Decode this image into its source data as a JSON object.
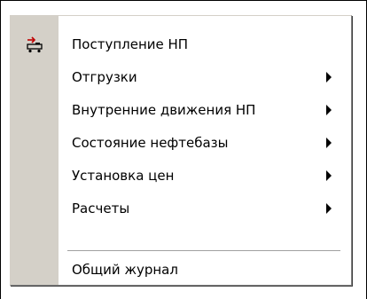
{
  "menu": {
    "items": [
      {
        "label": "Поступление НП",
        "icon": "fuel-truck-icon",
        "has_submenu": false
      },
      {
        "label": "Отгрузки",
        "has_submenu": true
      },
      {
        "label": "Внутренние движения НП",
        "has_submenu": true
      },
      {
        "label": "Состояние нефтебазы",
        "has_submenu": true
      },
      {
        "label": "Установка цен",
        "has_submenu": true
      },
      {
        "label": "Расчеты",
        "has_submenu": true
      },
      {
        "label": "Общий журнал",
        "has_submenu": false
      }
    ]
  },
  "colors": {
    "gutter": "#d4d0c8",
    "background": "#ffffff",
    "text": "#000000",
    "icon_accent": "#c00000"
  }
}
